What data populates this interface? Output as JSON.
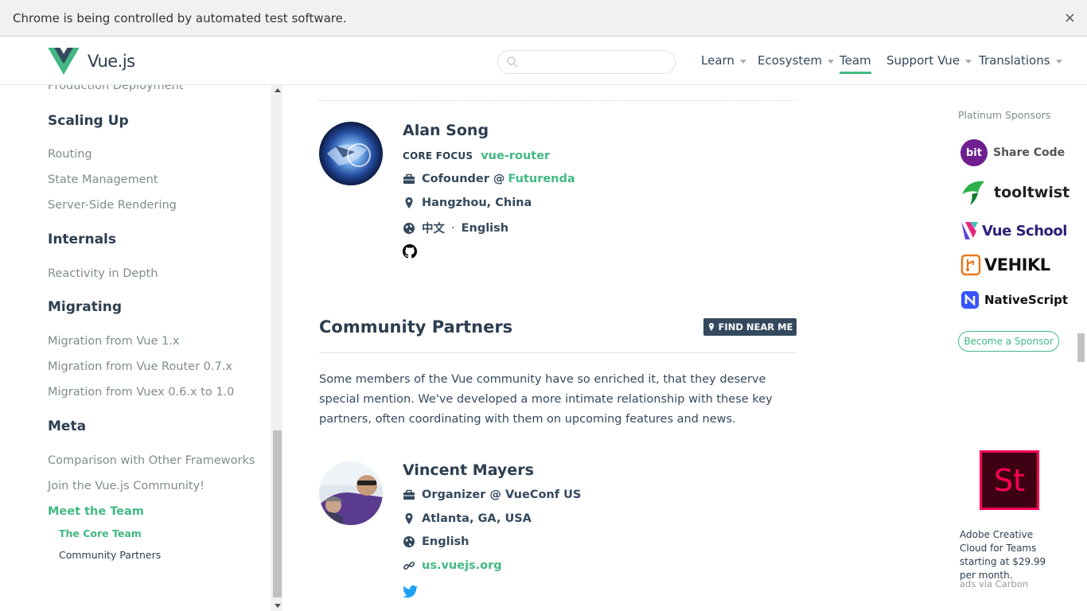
{
  "infobar": {
    "message": "Chrome is being controlled by automated test software.",
    "close_label": "×"
  },
  "header": {
    "brand": "Vue.js",
    "search": {
      "placeholder": "",
      "value": ""
    },
    "nav": [
      {
        "label": "Learn",
        "dropdown": true,
        "active": false
      },
      {
        "label": "Ecosystem",
        "dropdown": true,
        "active": false
      },
      {
        "label": "Team",
        "dropdown": false,
        "active": true
      },
      {
        "label": "Support Vue",
        "dropdown": true,
        "active": false
      },
      {
        "label": "Translations",
        "dropdown": true,
        "active": false
      }
    ]
  },
  "sidebar": {
    "partial_top": "Production Deployment",
    "sections": [
      {
        "title": "Scaling Up",
        "items": [
          "Routing",
          "State Management",
          "Server-Side Rendering"
        ]
      },
      {
        "title": "Internals",
        "items": [
          "Reactivity in Depth"
        ]
      },
      {
        "title": "Migrating",
        "items": [
          "Migration from Vue 1.x",
          "Migration from Vue Router 0.7.x",
          "Migration from Vuex 0.6.x to 1.0"
        ]
      },
      {
        "title": "Meta",
        "items": [
          "Comparison with Other Frameworks",
          "Join the Vue.js Community!",
          "Meet the Team"
        ]
      }
    ],
    "active_item": "Meet the Team",
    "sub_items": [
      "The Core Team",
      "Community Partners"
    ],
    "active_sub_item": "The Core Team"
  },
  "main": {
    "alan": {
      "name": "Alan Song",
      "core_focus_label": "CORE FOCUS",
      "core_focus_value": "vue-router",
      "role_prefix": "Cofounder @",
      "company": "Futurenda",
      "location": "Hangzhou, China",
      "lang1": "中文",
      "lang_sep": "·",
      "lang2": "English"
    },
    "partners_title": "Community Partners",
    "find_near_me": "FIND NEAR ME",
    "partners_desc": "Some members of the Vue community have so enriched it, that they deserve special mention. We've developed a more intimate relationship with these key partners, often coordinating with them on upcoming features and news.",
    "vincent": {
      "name": "Vincent Mayers",
      "role": "Organizer @ VueConf US",
      "location": "Atlanta, GA, USA",
      "language": "English",
      "website": "us.vuejs.org"
    }
  },
  "sponsors": {
    "title": "Platinum Sponsors",
    "items": [
      {
        "name": "Share Code",
        "badge": "bit",
        "color": "#6f1e8f"
      },
      {
        "name": "tooltwist",
        "color": "#1a7f3c"
      },
      {
        "name": "Vue School",
        "color": "#3b2a8c"
      },
      {
        "name": "VEHIKL",
        "color": "#e8781d"
      },
      {
        "name": "NativeScript",
        "color": "#3655ff"
      }
    ],
    "become": "Become a Sponsor",
    "carbon": {
      "badge": "St",
      "text": "Adobe Creative Cloud for Teams starting at $29.99 per month.",
      "via": "ads via Carbon"
    }
  },
  "colors": {
    "accent": "#42b983",
    "text": "#2c3e50",
    "muted": "#7f8c8d",
    "badge_bg": "#34495e"
  }
}
